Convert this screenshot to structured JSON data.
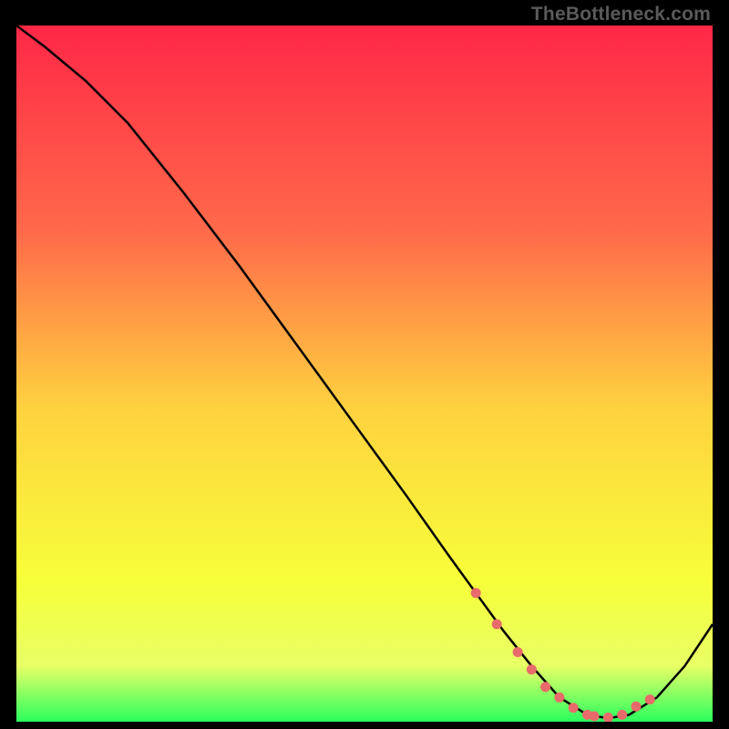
{
  "watermark": "TheBottleneck.com",
  "colors": {
    "gradient_top": "#ff2747",
    "gradient_upper_mid": "#ff6b4a",
    "gradient_mid": "#ffd23f",
    "gradient_lower_mid": "#f7ff3a",
    "gradient_low": "#e8ff66",
    "gradient_bottom": "#2aff5e",
    "curve": "#000000",
    "marker": "#e86a6a",
    "bg": "#000000"
  },
  "chart_data": {
    "type": "line",
    "title": "",
    "xlabel": "",
    "ylabel": "",
    "xlim": [
      0,
      100
    ],
    "ylim": [
      0,
      100
    ],
    "grid": false,
    "legend": false,
    "series": [
      {
        "name": "bottleneck-curve",
        "x": [
          0,
          4,
          10,
          16,
          24,
          32,
          40,
          48,
          56,
          62,
          66,
          70,
          74,
          78,
          82,
          85,
          88,
          92,
          96,
          100
        ],
        "y": [
          100,
          97,
          92,
          86,
          76,
          65.5,
          54.5,
          43.5,
          32.5,
          24,
          18.5,
          13,
          8,
          3.5,
          1,
          0.5,
          1,
          3.5,
          8,
          14
        ]
      }
    ],
    "markers": {
      "name": "highlight-dots",
      "x": [
        66,
        69,
        72,
        74,
        76,
        78,
        80,
        82,
        83,
        85,
        87,
        89,
        91
      ],
      "y": [
        18.5,
        14,
        10,
        7.5,
        5,
        3.5,
        2,
        1,
        0.8,
        0.6,
        1,
        2.2,
        3.2
      ]
    }
  }
}
